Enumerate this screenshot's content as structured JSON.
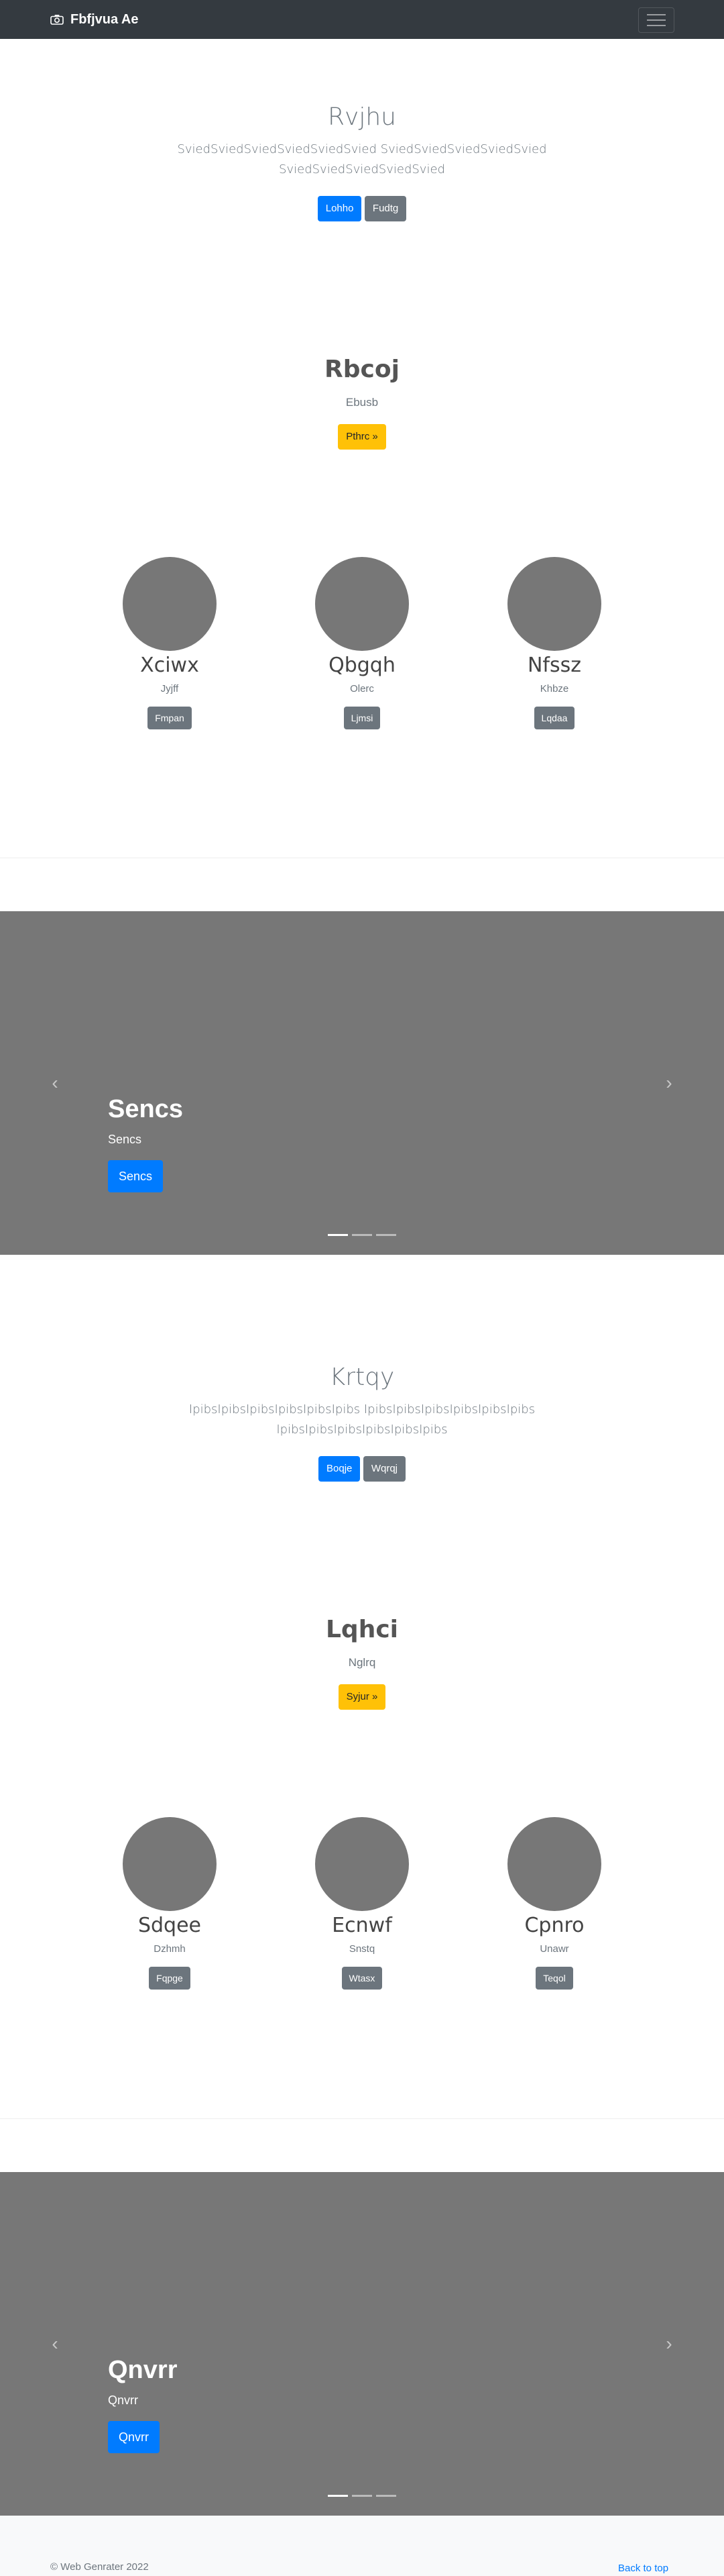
{
  "navbar": {
    "brand": "Fbfjvua Ae"
  },
  "hero1": {
    "title": "Rvjhu",
    "lead_line1": "SviedSviedSviedSviedSviedSvied SviedSviedSviedSviedSvied",
    "lead_line2": "SviedSviedSviedSviedSvied",
    "btn_primary": "Lohho",
    "btn_secondary": "Fudtg"
  },
  "section1": {
    "title": "Rbcoj",
    "subtitle": "Ebusb",
    "button": "Pthrc »"
  },
  "features1": [
    {
      "title": "Xciwx",
      "subtitle": "Jyjff",
      "button": "Fmpan"
    },
    {
      "title": "Qbgqh",
      "subtitle": "Olerc",
      "button": "Ljmsi"
    },
    {
      "title": "Nfssz",
      "subtitle": "Khbze",
      "button": "Lqdaa"
    }
  ],
  "carousel1": {
    "title": "Sencs",
    "text": "Sencs",
    "button": "Sencs"
  },
  "hero2": {
    "title": "Krtqy",
    "lead_line1": "IpibsIpibsIpibsIpibsIpibsIpibs IpibsIpibsIpibsIpibsIpibsIpibs",
    "lead_line2": "IpibsIpibsIpibsIpibsIpibsIpibs",
    "btn_primary": "Boqje",
    "btn_secondary": "Wqrqj"
  },
  "section2": {
    "title": "Lqhci",
    "subtitle": "Nglrq",
    "button": "Syjur »"
  },
  "features2": [
    {
      "title": "Sdqee",
      "subtitle": "Dzhmh",
      "button": "Fqpge"
    },
    {
      "title": "Ecnwf",
      "subtitle": "Snstq",
      "button": "Wtasx"
    },
    {
      "title": "Cpnro",
      "subtitle": "Unawr",
      "button": "Teqol"
    }
  ],
  "carousel2": {
    "title": "Qnvrr",
    "text": "Qnvrr",
    "button": "Qnvrr"
  },
  "footer": {
    "copyright": "© Web Genrater 2022",
    "back_to_top": "Back to top"
  },
  "colors": {
    "primary": "#007bff",
    "secondary": "#6c757d",
    "warning": "#ffc107",
    "navbar": "#343a40",
    "placeholder": "#777777"
  },
  "icons": {
    "brand": "camera-icon",
    "toggler": "hamburger-menu-icon",
    "prev": "chevron-left-icon",
    "next": "chevron-right-icon"
  }
}
